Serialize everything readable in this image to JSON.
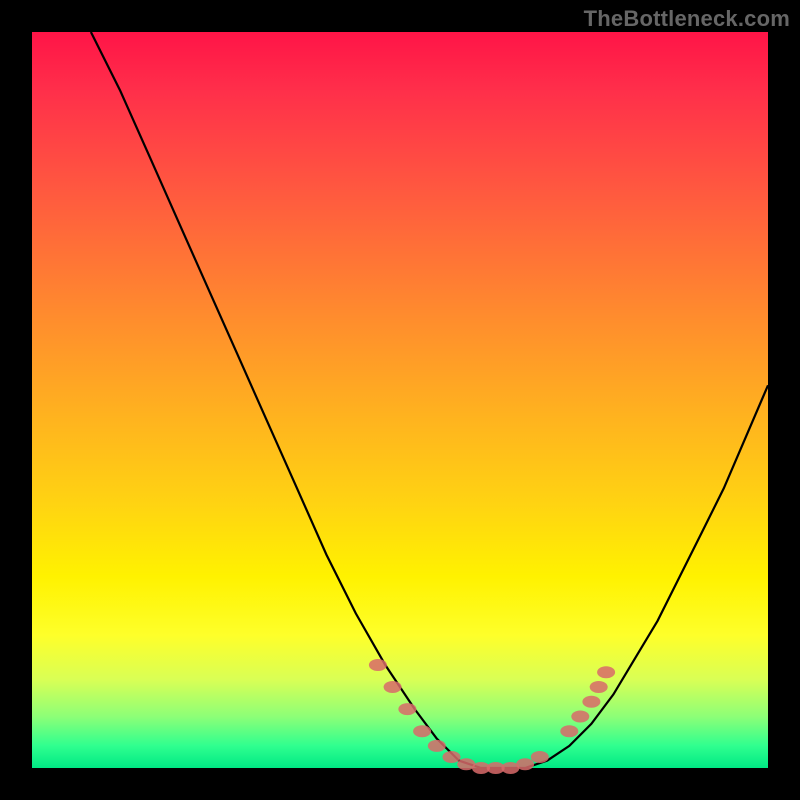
{
  "watermark": "TheBottleneck.com",
  "colors": {
    "background": "#000000",
    "gradient_top": "#ff1447",
    "gradient_mid": "#ffd312",
    "gradient_bottom": "#00e884",
    "curve": "#000000",
    "marker": "#d86a6a"
  },
  "chart_data": {
    "type": "line",
    "title": "",
    "xlabel": "",
    "ylabel": "",
    "xlim": [
      0,
      100
    ],
    "ylim": [
      0,
      100
    ],
    "series": [
      {
        "name": "bottleneck-curve",
        "x": [
          8,
          12,
          16,
          20,
          24,
          28,
          32,
          36,
          40,
          44,
          48,
          52,
          55,
          58,
          61,
          64,
          67,
          70,
          73,
          76,
          79,
          82,
          85,
          88,
          91,
          94,
          97,
          100
        ],
        "y": [
          100,
          92,
          83,
          74,
          65,
          56,
          47,
          38,
          29,
          21,
          14,
          8,
          4,
          1,
          0,
          0,
          0,
          1,
          3,
          6,
          10,
          15,
          20,
          26,
          32,
          38,
          45,
          52
        ]
      }
    ],
    "markers": {
      "name": "highlight-dots",
      "x": [
        47,
        49,
        51,
        53,
        55,
        57,
        59,
        61,
        63,
        65,
        67,
        69,
        73,
        74.5,
        76,
        77,
        78
      ],
      "y": [
        14,
        11,
        8,
        5,
        3,
        1.5,
        0.5,
        0,
        0,
        0,
        0.5,
        1.5,
        5,
        7,
        9,
        11,
        13
      ]
    }
  }
}
